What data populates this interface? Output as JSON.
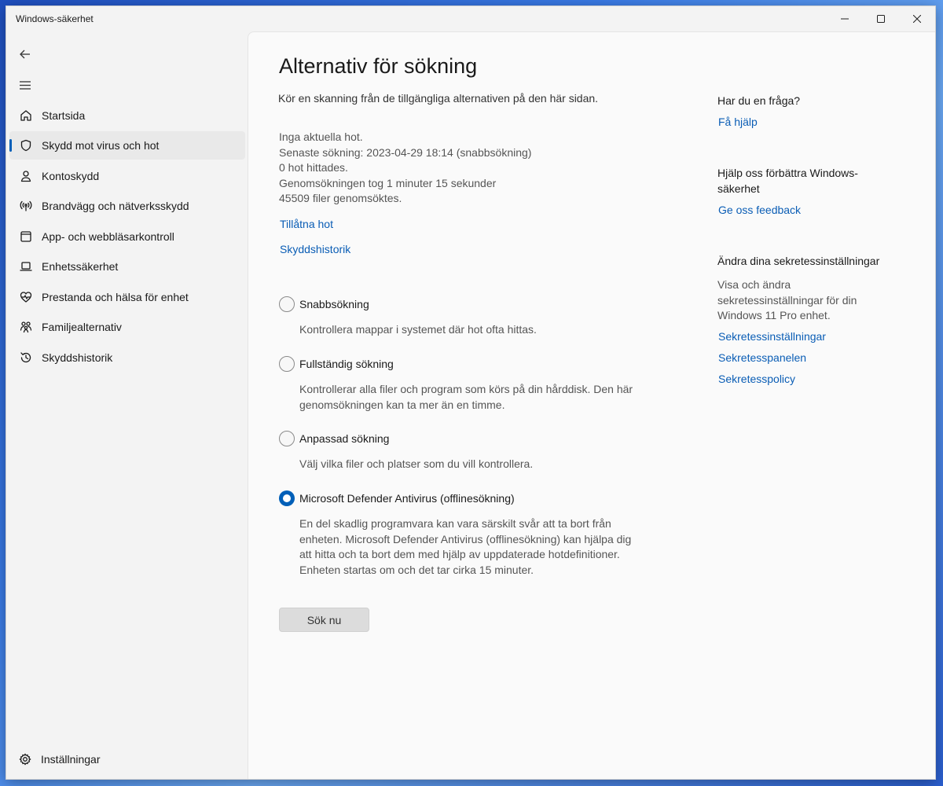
{
  "window": {
    "title": "Windows-säkerhet"
  },
  "sidebar": {
    "items": [
      {
        "label": "Startsida",
        "icon": "home-icon"
      },
      {
        "label": "Skydd mot virus och hot",
        "icon": "shield-icon",
        "active": true
      },
      {
        "label": "Kontoskydd",
        "icon": "person-icon"
      },
      {
        "label": "Brandvägg och nätverksskydd",
        "icon": "wireless-icon"
      },
      {
        "label": "App- och webbläsarkontroll",
        "icon": "app-window-icon"
      },
      {
        "label": "Enhetssäkerhet",
        "icon": "laptop-icon"
      },
      {
        "label": "Prestanda och hälsa för enhet",
        "icon": "heart-pulse-icon"
      },
      {
        "label": "Familjealternativ",
        "icon": "family-icon"
      },
      {
        "label": "Skyddshistorik",
        "icon": "history-icon"
      }
    ],
    "settings_label": "Inställningar"
  },
  "main": {
    "title": "Alternativ för sökning",
    "subtitle": "Kör en skanning från de tillgängliga alternativen på den här sidan.",
    "status": [
      "Inga aktuella hot.",
      "Senaste sökning: 2023-04-29 18:14 (snabbsökning)",
      "0 hot hittades.",
      "Genomsökningen tog 1 minuter 15 sekunder",
      "45509 filer genomsöktes."
    ],
    "links": {
      "allowed_threats": "Tillåtna hot",
      "protection_history": "Skyddshistorik"
    },
    "options": [
      {
        "title": "Snabbsökning",
        "desc": [
          "Kontrollera mappar i systemet där hot ofta hittas."
        ],
        "selected": false
      },
      {
        "title": "Fullständig sökning",
        "desc": [
          "Kontrollerar alla filer och program som körs på din hårddisk. Den här",
          "genomsökningen kan ta mer än en timme."
        ],
        "selected": false
      },
      {
        "title": "Anpassad sökning",
        "desc": [
          "Välj vilka filer och platser som du vill kontrollera."
        ],
        "selected": false
      },
      {
        "title": "Microsoft Defender Antivirus (offlinesökning)",
        "desc": [
          "En del skadlig programvara kan vara särskilt svår att ta bort från",
          "enheten. Microsoft Defender Antivirus (offlinesökning) kan hjälpa dig",
          "att hitta och ta bort dem med hjälp av uppdaterade hotdefinitioner.",
          "Enheten startas om och det tar cirka 15 minuter."
        ],
        "selected": true
      }
    ],
    "scan_button": "Sök nu"
  },
  "right": {
    "question_heading": "Har du en fråga?",
    "help_link": "Få hjälp",
    "improve_heading_lines": [
      "Hjälp oss förbättra Windows-",
      "säkerhet"
    ],
    "feedback_link": "Ge oss feedback",
    "privacy_heading": "Ändra dina sekretessinställningar",
    "privacy_text_lines": [
      "Visa och ändra",
      "sekretessinställningar för din",
      "Windows 11 Pro enhet."
    ],
    "privacy_links": [
      "Sekretessinställningar",
      "Sekretesspanelen",
      "Sekretesspolicy"
    ]
  },
  "colors": {
    "accent": "#005fb8",
    "link": "#0a5db5"
  }
}
